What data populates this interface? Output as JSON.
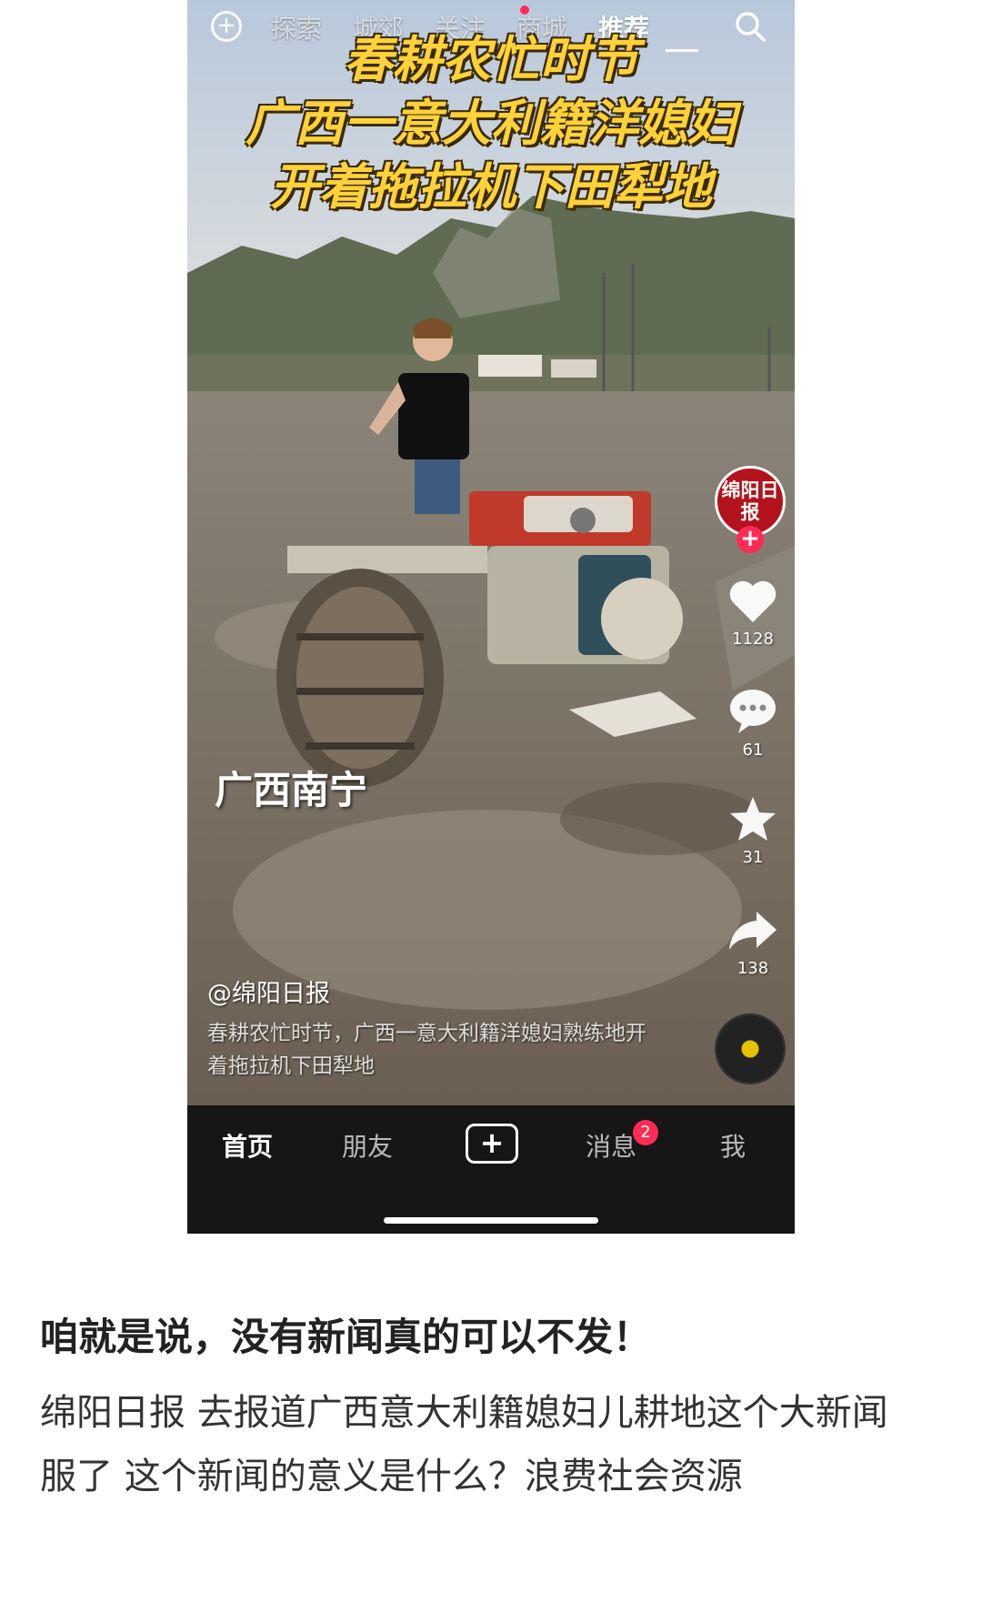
{
  "top_nav": {
    "add_icon": "plus-circle-icon",
    "tabs": [
      "探索",
      "城郊",
      "关注",
      "商城",
      "推荐"
    ],
    "active_tab": "推荐",
    "search_icon": "search-icon"
  },
  "video": {
    "headline": [
      "春耕农忙时节",
      "广西一意大利籍洋媳妇",
      "开着拖拉机下田犁地"
    ],
    "location_tag": "广西南宁",
    "author": "@绵阳日报",
    "caption": "春耕农忙时节，广西一意大利籍洋媳妇熟练地开着拖拉机下田犁地"
  },
  "sidebar": {
    "avatar_text": "绵阳日报",
    "follow_label": "+",
    "likes": "1128",
    "comments": "61",
    "favorites": "31",
    "shares": "138"
  },
  "bottom_nav": {
    "items": [
      "首页",
      "朋友",
      "消息",
      "我"
    ],
    "create_label": "+",
    "messages_badge": "2"
  },
  "post": {
    "title": "咱就是说，没有新闻真的可以不发！",
    "lines": [
      "绵阳日报 去报道广西意大利籍媳妇儿耕地这个大新闻",
      "服了 这个新闻的意义是什么？浪费社会资源"
    ]
  },
  "colors": {
    "headline": "#ffd23a",
    "accent": "#fe2c55",
    "avatar_bg": "#b3131d"
  }
}
